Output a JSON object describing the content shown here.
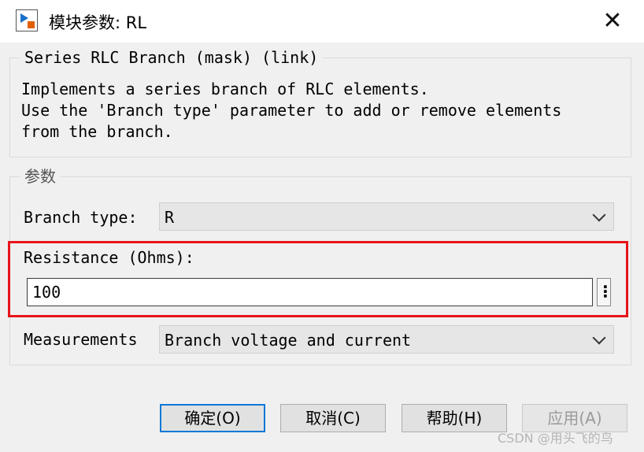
{
  "window": {
    "title": "模块参数: RL",
    "icon": "simulink-block-icon",
    "close_label": "✕"
  },
  "description": {
    "legend": "Series RLC Branch (mask) (link)",
    "text": "Implements a series branch of RLC elements.\nUse the 'Branch type' parameter to add or remove elements\nfrom the branch."
  },
  "parameters": {
    "legend": "参数",
    "branch_type": {
      "label": "Branch type:",
      "value": "R"
    },
    "resistance": {
      "label": "Resistance (Ohms):",
      "value": "100",
      "more_label": "⋮"
    },
    "measurements": {
      "label": "Measurements",
      "value": "Branch voltage and current"
    }
  },
  "buttons": {
    "ok": "确定(O)",
    "cancel": "取消(C)",
    "help": "帮助(H)",
    "apply": "应用(A)"
  },
  "watermark": "CSDN @用头飞的鸟",
  "colors": {
    "highlight": "#e8141a",
    "focus_border": "#0078d7",
    "dialog_bg": "#f0f0f0"
  }
}
